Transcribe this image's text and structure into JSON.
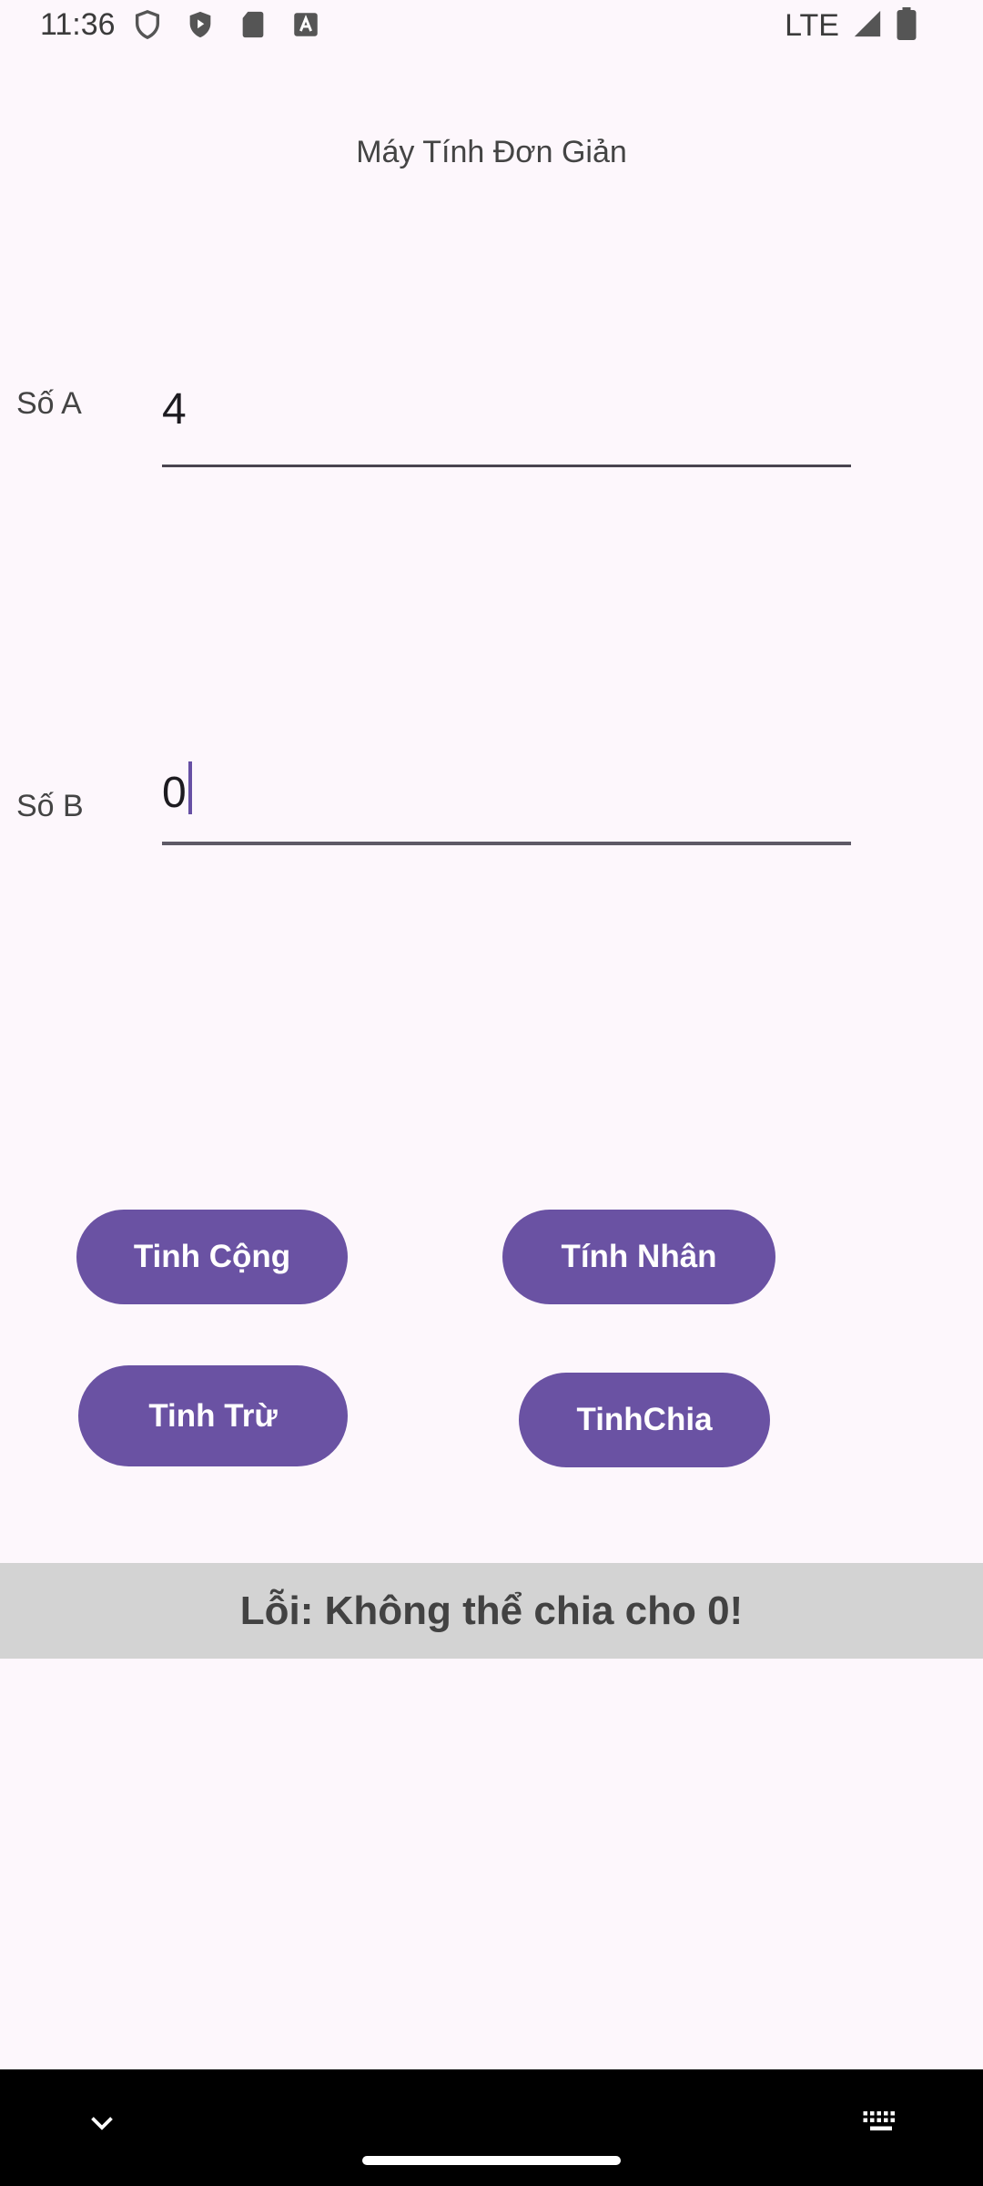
{
  "status": {
    "time": "11:36",
    "network": "LTE"
  },
  "app": {
    "title": "Máy Tính Đơn Giản"
  },
  "form": {
    "a_label": "Số A",
    "a_value": "4",
    "b_label": "Số B",
    "b_value": "0"
  },
  "buttons": {
    "add": "Tinh Cộng",
    "multiply": "Tính Nhân",
    "subtract": "Tinh Trừ",
    "divide": "TinhChia"
  },
  "result": {
    "text": "Lỗi: Không thể chia cho 0!"
  },
  "colors": {
    "accent": "#6A52A3",
    "background": "#FDF7FC",
    "result_bg": "#D3D3D3"
  }
}
